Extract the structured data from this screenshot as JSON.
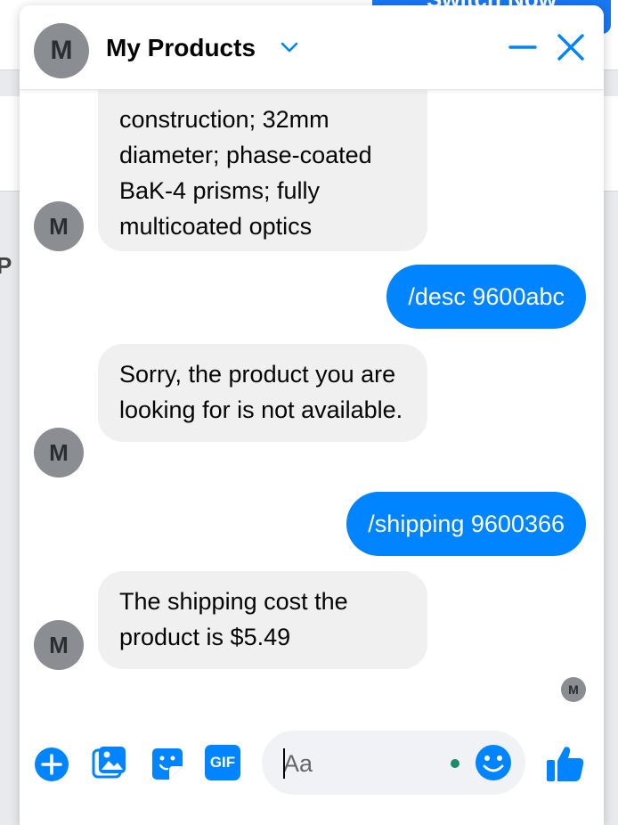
{
  "background": {
    "banner_text": "Switch Now",
    "fragment_text": "P"
  },
  "chat": {
    "title": "My Products",
    "avatar_letter": "M"
  },
  "messages": [
    {
      "from": "bot",
      "text": "construction; 32mm diameter; phase-coated BaK-4 prisms; fully multicoated optics"
    },
    {
      "from": "user",
      "text": "/desc 9600abc"
    },
    {
      "from": "bot",
      "text": "Sorry, the product you are looking for is not available."
    },
    {
      "from": "user",
      "text": "/shipping 9600366"
    },
    {
      "from": "bot",
      "text": "The shipping cost the product is $5.49"
    }
  ],
  "composer": {
    "placeholder": "Aa",
    "gif_label": "GIF"
  },
  "icons": {
    "chevron": "chevron-down-icon",
    "minimize": "minimize-icon",
    "close": "close-icon",
    "add": "plus-circle-icon",
    "photo": "photo-icon",
    "sticker": "sticker-icon",
    "gif": "gif-icon",
    "emoji": "emoji-icon",
    "like": "thumbs-up-icon"
  },
  "colors": {
    "accent": "#0084ff",
    "incoming_bubble": "#f0f0f0",
    "avatar": "#8a8d91"
  }
}
